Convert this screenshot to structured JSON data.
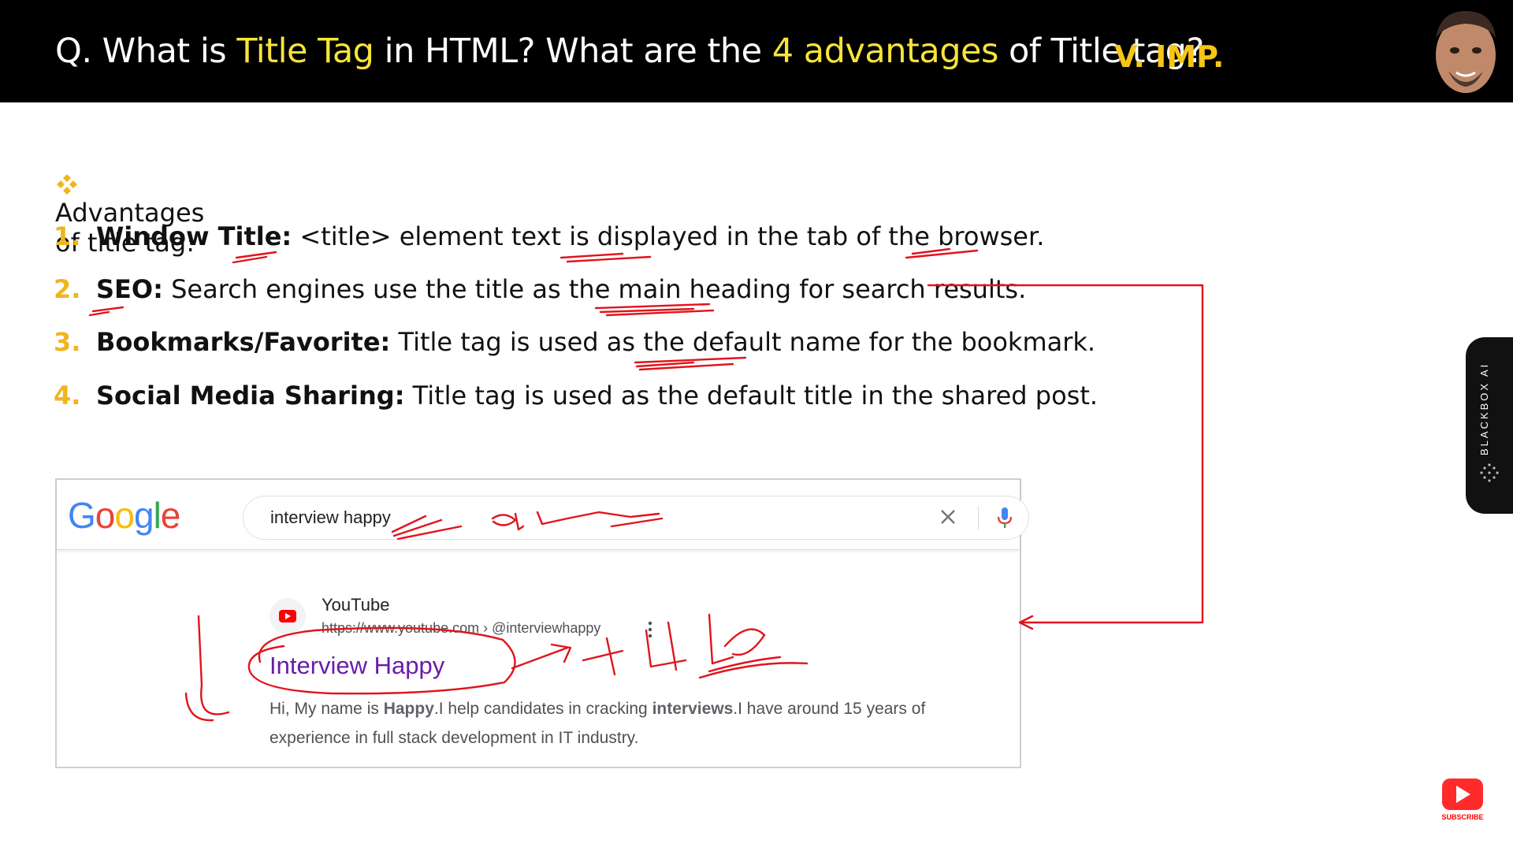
{
  "header": {
    "question_parts": [
      "Q. What is ",
      "Title Tag",
      " in HTML? What are the ",
      "4 advantages",
      " of Title tag?"
    ],
    "importance": "V. IMP."
  },
  "advantages": {
    "heading": "Advantages of title tag:",
    "items": [
      {
        "num": "1.",
        "term": "Window Title:",
        "text": " <title> element text is displayed in the tab of the browser."
      },
      {
        "num": "2.",
        "term": "SEO:",
        "text": " Search engines use the title as the main heading for search results."
      },
      {
        "num": "3.",
        "term": "Bookmarks/Favorite:",
        "text": " Title tag is used as the default name for the bookmark."
      },
      {
        "num": "4.",
        "term": "Social Media Sharing:",
        "text": " Title tag is used as the default title in the shared post."
      }
    ]
  },
  "google": {
    "logo_letters": [
      "G",
      "o",
      "o",
      "g",
      "l",
      "e"
    ],
    "logo_colors": [
      "#4285F4",
      "#EA4335",
      "#FBBC05",
      "#4285F4",
      "#34A853",
      "#EA4335"
    ],
    "query": "interview happy",
    "result": {
      "site": "YouTube",
      "url": "https://www.youtube.com › @interviewhappy",
      "title": "Interview Happy",
      "snippet_parts": [
        "Hi, My name is ",
        "Happy",
        ".I help candidates in cracking ",
        "interviews",
        ".I have around 15 years of experience in full stack development in IT industry."
      ]
    }
  },
  "sidebar": {
    "label": "BLACKBOX AI"
  },
  "subscribe": {
    "label": "SUBSCRIBE"
  },
  "colors": {
    "highlight": "#f7e33a",
    "number": "#f0b51d",
    "annotation": "#e0141c"
  }
}
